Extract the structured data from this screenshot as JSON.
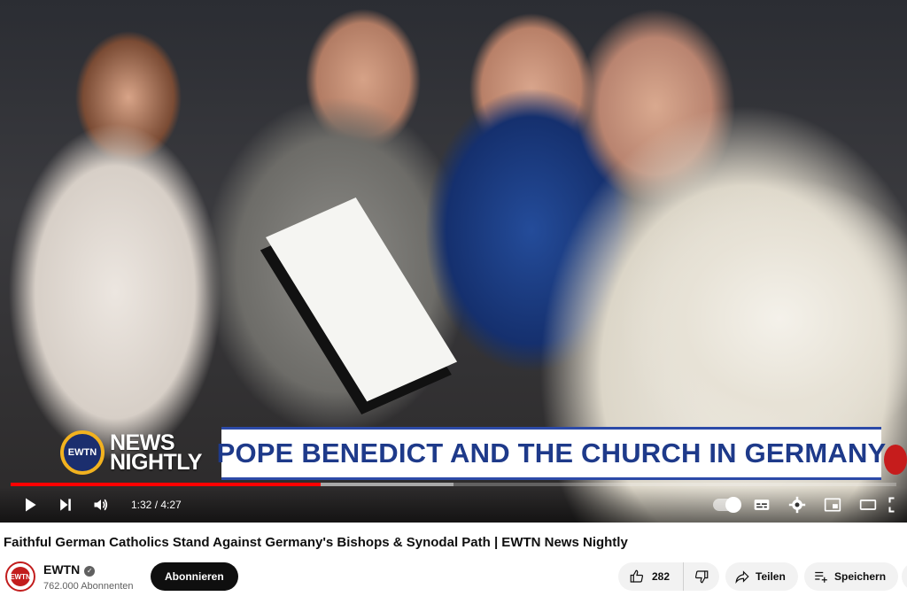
{
  "video": {
    "overlay": {
      "brand_line1": "NEWS",
      "brand_line2": "NIGHTLY",
      "logo_text": "EWTN",
      "headline": "POPE BENEDICT AND THE CHURCH IN GERMANY"
    },
    "progress": {
      "played_fraction": 0.35,
      "loaded_fraction": 0.5
    },
    "time_display": "1:32 / 4:27",
    "controls": [
      "play-icon",
      "next-icon",
      "volume-icon",
      "autoplay-toggle",
      "subtitles-icon",
      "settings-icon",
      "miniplayer-icon",
      "theater-icon",
      "fullscreen-icon"
    ]
  },
  "title": "Faithful German Catholics Stand Against Germany's Bishops & Synodal Path | EWTN News Nightly",
  "channel": {
    "name": "EWTN",
    "avatar_text": "EWTN",
    "verified_mark": "✓",
    "subscribers": "762.000 Abonnenten",
    "subscribe_label": "Abonnieren"
  },
  "actions": {
    "likes": "282",
    "share_label": "Teilen",
    "save_label": "Speichern"
  },
  "colors": {
    "accent_red": "#ff0000",
    "headline_blue": "#1e3a8a",
    "subscribe_bg": "#0f0f0f"
  }
}
